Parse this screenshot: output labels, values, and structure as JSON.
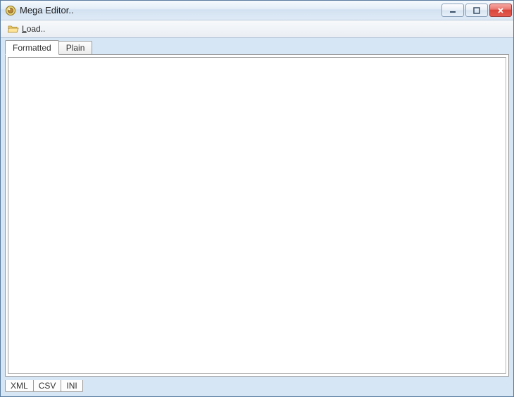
{
  "window": {
    "title": "Mega Editor.."
  },
  "toolbar": {
    "load_label": "Load.."
  },
  "tabs": {
    "top": [
      {
        "label": "Formatted",
        "active": true
      },
      {
        "label": "Plain",
        "active": false
      }
    ],
    "bottom": [
      {
        "label": "XML"
      },
      {
        "label": "CSV"
      },
      {
        "label": "INI"
      }
    ]
  },
  "editor": {
    "content": ""
  }
}
